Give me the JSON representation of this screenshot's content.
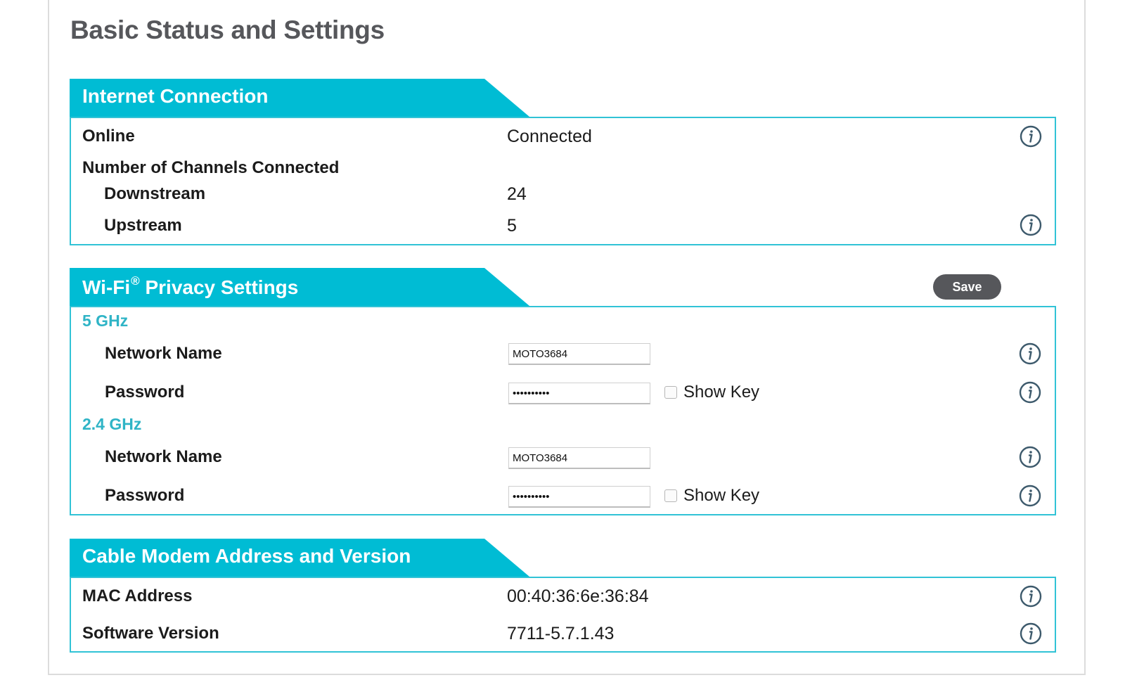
{
  "page": {
    "title": "Basic Status and Settings"
  },
  "internet": {
    "title": "Internet Connection",
    "online_label": "Online",
    "online_value": "Connected",
    "channels_label": "Number of Channels Connected",
    "downstream_label": "Downstream",
    "downstream_value": "24",
    "upstream_label": "Upstream",
    "upstream_value": "5"
  },
  "wifi": {
    "title_main": "Wi-Fi",
    "title_mark": "®",
    "title_rest": " Privacy Settings",
    "save_label": "Save",
    "band_5": {
      "label": "5 GHz",
      "network_name_label": "Network Name",
      "network_name_value": "MOTO3684",
      "password_label": "Password",
      "password_value": "••••••••••",
      "show_key_label": "Show Key"
    },
    "band_24": {
      "label": "2.4 GHz",
      "network_name_label": "Network Name",
      "network_name_value": "MOTO3684",
      "password_label": "Password",
      "password_value": "••••••••••",
      "show_key_label": "Show Key"
    }
  },
  "modem": {
    "title": "Cable Modem Address and Version",
    "mac_label": "MAC Address",
    "mac_value": "00:40:36:6e:36:84",
    "software_label": "Software Version",
    "software_value": "7711-5.7.1.43"
  },
  "colors": {
    "accent": "#00bcd4",
    "band_label": "#2fb4c6",
    "title_gray": "#56575b",
    "save_button": "#56575b",
    "icon_stroke": "#3d5a6c"
  },
  "icons": {
    "info": "info-circle-icon"
  }
}
